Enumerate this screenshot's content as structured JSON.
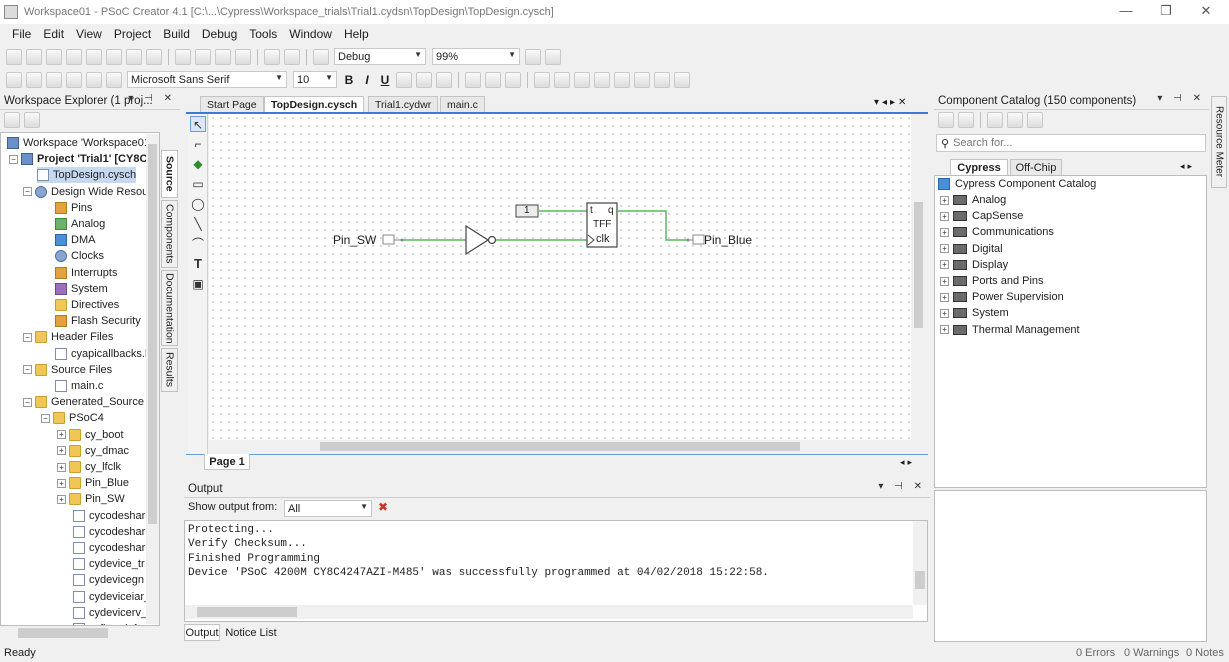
{
  "window": {
    "title": "Workspace01 - PSoC Creator 4.1  [C:\\...\\Cypress\\Workspace_trials\\Trial1.cydsn\\TopDesign\\TopDesign.cysch]",
    "minimize": "—",
    "maximize": "❐",
    "close": "✕"
  },
  "menu": [
    "File",
    "Edit",
    "View",
    "Project",
    "Build",
    "Debug",
    "Tools",
    "Window",
    "Help"
  ],
  "toolbar1": {
    "config": "Debug",
    "zoom": "99%"
  },
  "toolbar2": {
    "font": "Microsoft Sans Serif",
    "size": "10",
    "bold": "B",
    "italic": "I",
    "underline": "U"
  },
  "workspace_explorer": {
    "title": "Workspace Explorer (1 proj...",
    "items": [
      {
        "label": "Workspace 'Workspace01'"
      },
      {
        "label": "Project 'Trial1' [CY8C"
      },
      {
        "label": "TopDesign.cysch"
      },
      {
        "label": "Design Wide Resou"
      },
      {
        "label": "Pins"
      },
      {
        "label": "Analog"
      },
      {
        "label": "DMA"
      },
      {
        "label": "Clocks"
      },
      {
        "label": "Interrupts"
      },
      {
        "label": "System"
      },
      {
        "label": "Directives"
      },
      {
        "label": "Flash Security"
      },
      {
        "label": "Header Files"
      },
      {
        "label": "cyapicallbacks.h"
      },
      {
        "label": "Source Files"
      },
      {
        "label": "main.c"
      },
      {
        "label": "Generated_Source"
      },
      {
        "label": "PSoC4"
      },
      {
        "label": "cy_boot"
      },
      {
        "label": "cy_dmac"
      },
      {
        "label": "cy_lfclk"
      },
      {
        "label": "Pin_Blue"
      },
      {
        "label": "Pin_SW"
      },
      {
        "label": "cycodeshar"
      },
      {
        "label": "cycodeshar"
      },
      {
        "label": "cycodeshar"
      },
      {
        "label": "cydevice_tr"
      },
      {
        "label": "cydevicegn"
      },
      {
        "label": "cydeviceiar_"
      },
      {
        "label": "cydevicerv_"
      },
      {
        "label": "cyfitterdef"
      }
    ],
    "vtabs": [
      "Source",
      "Components",
      "Documentation",
      "Results"
    ]
  },
  "doc_tabs": [
    "Start Page",
    "TopDesign.cysch",
    "Trial1.cydwr",
    "main.c"
  ],
  "schematic": {
    "pin_sw": "Pin_SW",
    "pin_blue": "Pin_Blue",
    "const_value": "1",
    "tff_t": "t",
    "tff_q": "q",
    "tff_name": "TFF",
    "tff_clk": "clk",
    "page_tab": "Page 1"
  },
  "catalog": {
    "title": "Component Catalog (150 components)",
    "search_placeholder": "Search for...",
    "tabs": [
      "Cypress",
      "Off-Chip"
    ],
    "root": "Cypress Component Catalog",
    "items": [
      "Analog",
      "CapSense",
      "Communications",
      "Digital",
      "Display",
      "Ports and Pins",
      "Power Supervision",
      "System",
      "Thermal Management"
    ],
    "side_tab": "Resource Meter"
  },
  "output": {
    "title": "Output",
    "from_label": "Show output from:",
    "from_value": "All",
    "lines": [
      "Protecting...",
      "Verify Checksum...",
      "Finished Programming",
      "Device 'PSoC 4200M CY8C4247AZI-M485' was successfully programmed at 04/02/2018 15:22:58."
    ],
    "tabs": [
      "Output",
      "Notice List"
    ]
  },
  "status": {
    "left": "Ready",
    "errors": "0 Errors",
    "warnings": "0 Warnings",
    "notes": "0 Notes"
  }
}
